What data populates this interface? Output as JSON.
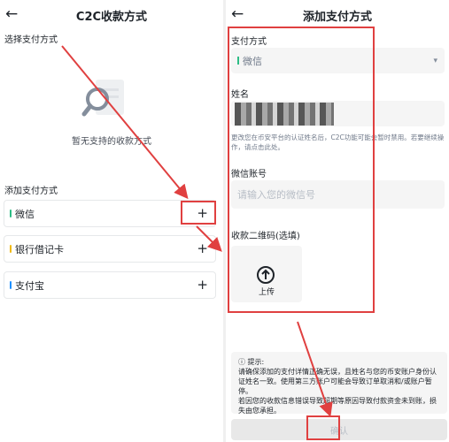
{
  "left": {
    "header": {
      "title": "C2C收款方式",
      "back_icon": "←"
    },
    "select_label": "选择支付方式",
    "empty_text": "暂无支持的收款方式",
    "add_label": "添加支付方式",
    "methods": [
      {
        "label": "微信",
        "bar_color": "#2dbd85",
        "add_icon": "+"
      },
      {
        "label": "银行借记卡",
        "bar_color": "#f0b90b",
        "add_icon": "+"
      },
      {
        "label": "支付宝",
        "bar_color": "#1e90ff",
        "add_icon": "+"
      }
    ]
  },
  "right": {
    "header": {
      "title": "添加支付方式",
      "back_icon": "←"
    },
    "payment_method": {
      "label": "支付方式",
      "value": "微信",
      "chevron": "▾"
    },
    "name": {
      "label": "姓名"
    },
    "name_hint": "更改您在币安平台的认证姓名后，C2C功能可能会暂时禁用。若要继续操作，请点击此处。",
    "wechat_account": {
      "label": "微信账号",
      "placeholder": "请输入您的微信号"
    },
    "qr": {
      "label": "收款二维码(选填)",
      "upload_label": "上传"
    },
    "notice": {
      "title": "提示:",
      "line1": "请确保添加的支付详情正确无误，且姓名与您的币安账户身份认证姓名一致。使用第三方账户可能会导致订单取消和/或账户暂停。",
      "line2": "若因您的收款信息错误导致超期等原因导致付款资金未到账，损失由您承担。"
    },
    "confirm_label": "确认"
  },
  "colors": {
    "annotation": "#e04040",
    "wechat": "#2dbd85",
    "bank": "#f0b90b",
    "alipay": "#1e90ff"
  }
}
